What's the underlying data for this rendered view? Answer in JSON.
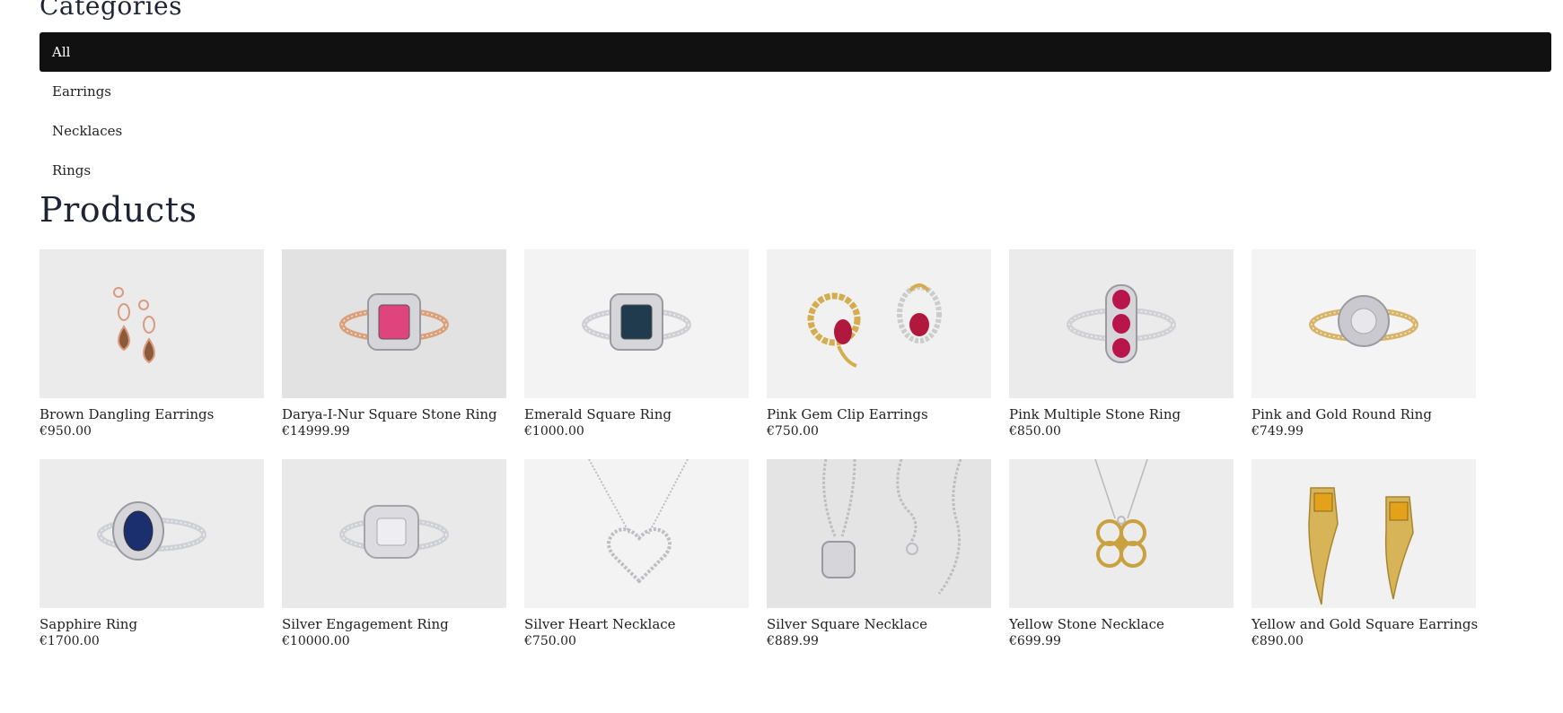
{
  "categories": {
    "title": "Categories",
    "items": [
      {
        "label": "All",
        "active": true
      },
      {
        "label": "Earrings",
        "active": false
      },
      {
        "label": "Necklaces",
        "active": false
      },
      {
        "label": "Rings",
        "active": false
      }
    ]
  },
  "products": {
    "title": "Products",
    "items": [
      {
        "name": "Brown Dangling Earrings",
        "price": "€950.00",
        "image": "rose-gold-drop-earrings",
        "stone": "#8a5a3a",
        "metal": "#d99a80",
        "bg": "#ebebeb"
      },
      {
        "name": "Darya-I-Nur Square Stone Ring",
        "price": "€14999.99",
        "image": "pink-square-ring",
        "stone": "#e0447c",
        "metal": "#d9a07a",
        "bg": "#e2e2e2"
      },
      {
        "name": "Emerald Square Ring",
        "price": "€1000.00",
        "image": "blue-green-square-ring",
        "stone": "#1f3b4d",
        "metal": "#cfcfd4",
        "bg": "#f3f3f3"
      },
      {
        "name": "Pink Gem Clip Earrings",
        "price": "€750.00",
        "image": "gold-ruby-clip-earrings",
        "stone": "#b0183e",
        "metal": "#d4ad4f",
        "bg": "#f1f1f1"
      },
      {
        "name": "Pink Multiple Stone Ring",
        "price": "€850.00",
        "image": "ruby-three-stone-ring",
        "stone": "#b8164a",
        "metal": "#d0d0d5",
        "bg": "#ebebeb"
      },
      {
        "name": "Pink and Gold Round Ring",
        "price": "€749.99",
        "image": "round-halo-ring",
        "stone": "#c9c9cf",
        "metal": "#d8b46a",
        "bg": "#f4f4f4"
      },
      {
        "name": "Sapphire Ring",
        "price": "€1700.00",
        "image": "sapphire-ring",
        "stone": "#1b2e6e",
        "metal": "#cfd0d5",
        "bg": "#ececec"
      },
      {
        "name": "Silver Engagement Ring",
        "price": "€10000.00",
        "image": "silver-cushion-ring",
        "stone": "#d5d5da",
        "metal": "#cfd0d5",
        "bg": "#e9e9e9"
      },
      {
        "name": "Silver Heart Necklace",
        "price": "€750.00",
        "image": "heart-necklace",
        "stone": "#d5d5da",
        "metal": "#bdbdc2",
        "bg": "#f3f3f3"
      },
      {
        "name": "Silver Square Necklace",
        "price": "€889.99",
        "image": "square-pendant-necklace",
        "stone": "#d5d5da",
        "metal": "#bdbdc2",
        "bg": "#e4e4e4"
      },
      {
        "name": "Yellow Stone Necklace",
        "price": "€699.99",
        "image": "gold-flower-necklace",
        "stone": "#c9a13e",
        "metal": "#c9a13e",
        "bg": "#ececec"
      },
      {
        "name": "Yellow and Gold Square Earrings",
        "price": "€890.00",
        "image": "citrine-horn-earrings",
        "stone": "#e3a21a",
        "metal": "#d8b458",
        "bg": "#f1f1f1"
      }
    ]
  }
}
